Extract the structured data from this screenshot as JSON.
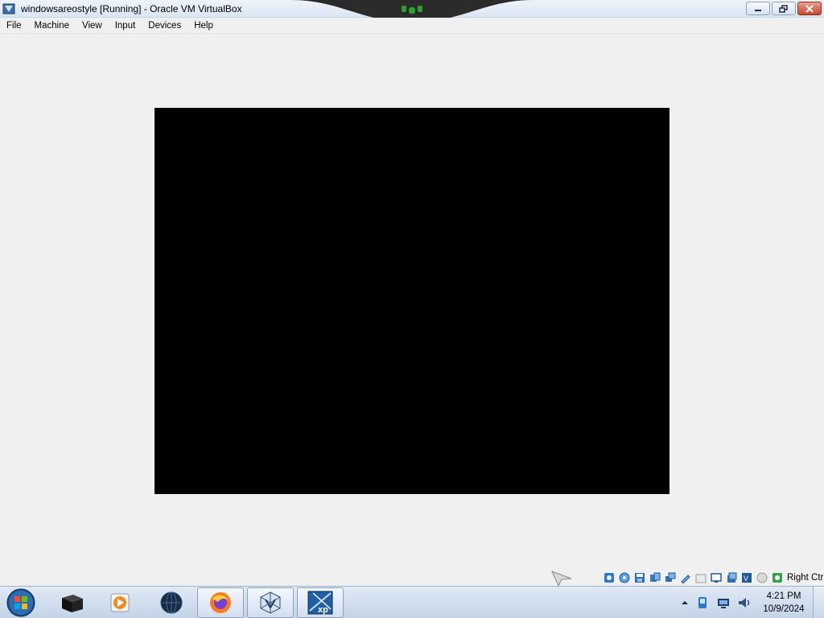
{
  "window": {
    "title": "windowsareostyle [Running] - Oracle VM VirtualBox",
    "controls": [
      "minimize",
      "restore",
      "close"
    ]
  },
  "menubar": {
    "items": [
      "File",
      "Machine",
      "View",
      "Input",
      "Devices",
      "Help"
    ]
  },
  "statusbar": {
    "icons": [
      "hard-disk-icon",
      "optical-drive-icon",
      "floppy-icon",
      "audio-icon",
      "network-icon",
      "usb-icon",
      "shared-folders-icon",
      "display-icon",
      "video-capture-icon",
      "virtualization-icon",
      "cpu-icon",
      "mouse-integration-icon",
      "keyboard-icon"
    ],
    "host_key": "Right Ctrl"
  },
  "taskbar": {
    "apps": [
      {
        "name": "taskbar-app-box",
        "icon": "black-box-icon",
        "active": false
      },
      {
        "name": "taskbar-app-media-player",
        "icon": "media-player-icon",
        "active": false
      },
      {
        "name": "taskbar-app-globe",
        "icon": "dark-globe-icon",
        "active": false
      },
      {
        "name": "taskbar-app-firefox",
        "icon": "firefox-icon",
        "active": true
      },
      {
        "name": "taskbar-app-virtualbox",
        "icon": "virtualbox-icon",
        "active": true
      },
      {
        "name": "taskbar-app-windows-xp",
        "icon": "windows-xp-icon",
        "active": true
      }
    ],
    "clock": {
      "time": "4:21 PM",
      "date": "10/9/2024"
    }
  },
  "colors": {
    "vm_screen": "#000000",
    "workspace": "#f0f0f0",
    "accent": "#3a6ea5"
  }
}
